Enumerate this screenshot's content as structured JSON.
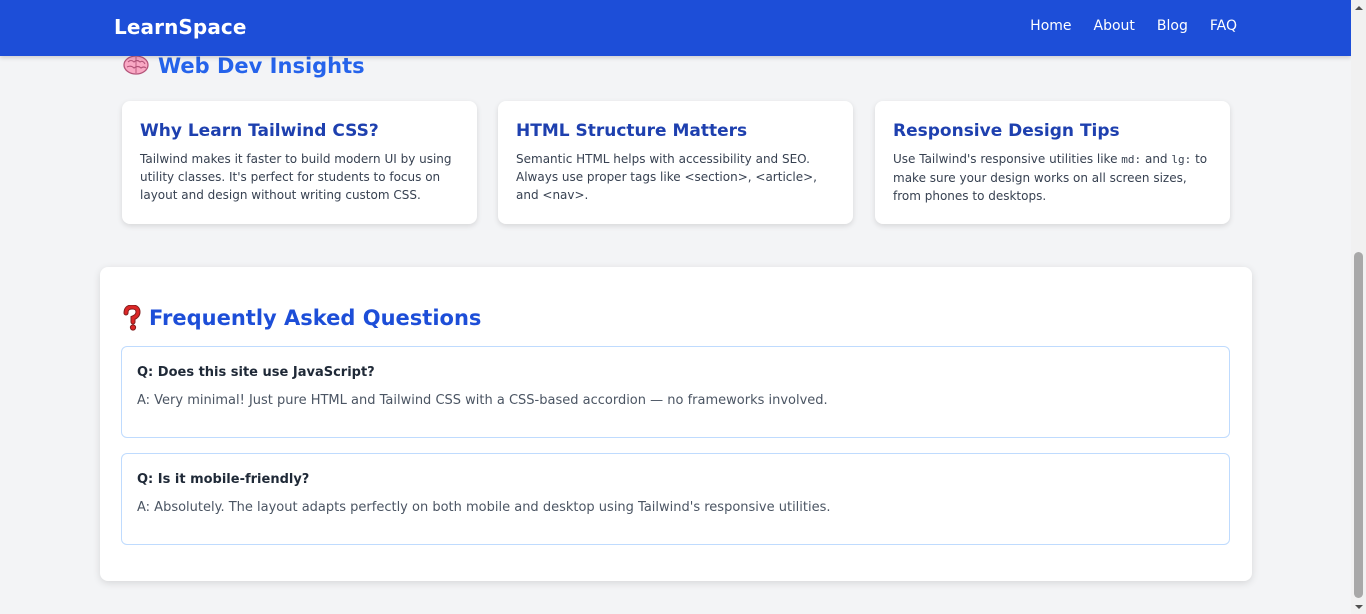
{
  "navbar": {
    "brand": "LearnSpace",
    "links": [
      "Home",
      "About",
      "Blog",
      "FAQ"
    ],
    "color": "#1d4ed8"
  },
  "insights": {
    "icon": "brain-icon",
    "title": "Web Dev Insights",
    "cards": [
      {
        "title": "Why Learn Tailwind CSS?",
        "body": "Tailwind makes it faster to build modern UI by using utility classes. It's perfect for students to focus on layout and design without writing custom CSS."
      },
      {
        "title": "HTML Structure Matters",
        "body": "Semantic HTML helps with accessibility and SEO. Always use proper tags like <section>, <article>, and <nav>."
      },
      {
        "title": "Responsive Design Tips",
        "body_pre": "Use Tailwind's responsive utilities like ",
        "code1": "md:",
        "body_mid": " and ",
        "code2": "lg:",
        "body_post": " to make sure your design works on all screen sizes, from phones to desktops."
      }
    ]
  },
  "faq": {
    "icon": "question-mark-icon",
    "title": "Frequently Asked Questions",
    "items": [
      {
        "question": "Q: Does this site use JavaScript?",
        "answer": "A: Very minimal! Just pure HTML and Tailwind CSS with a CSS-based accordion — no frameworks involved."
      },
      {
        "question": "Q: Is it mobile-friendly?",
        "answer": "A: Absolutely. The layout adapts perfectly on both mobile and desktop using Tailwind's responsive utilities."
      }
    ]
  }
}
